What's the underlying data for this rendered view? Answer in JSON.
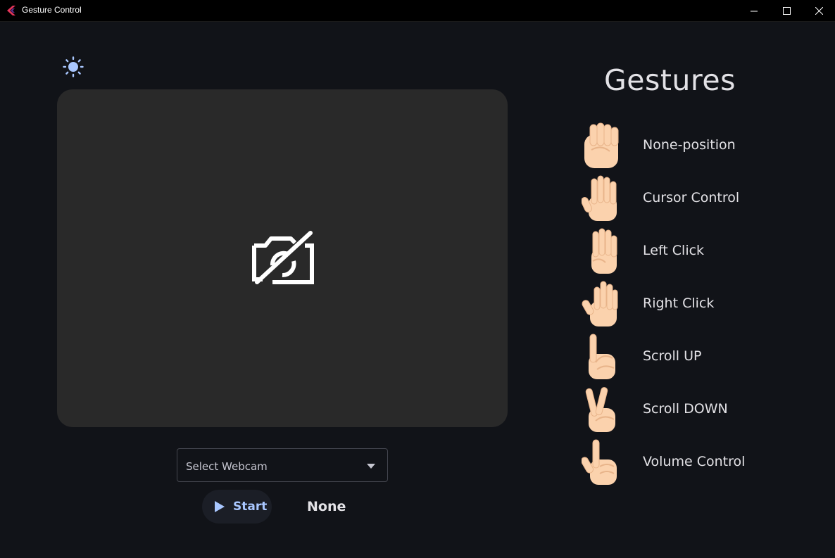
{
  "window": {
    "title": "Gesture Control"
  },
  "controls": {
    "webcam_placeholder": "Select Webcam",
    "start_label": "Start",
    "status": "None"
  },
  "gestures": {
    "title": "Gestures",
    "items": [
      {
        "label": "None-position",
        "icon": "fist-hand-icon"
      },
      {
        "label": "Cursor Control",
        "icon": "open-palm-icon"
      },
      {
        "label": "Left Click",
        "icon": "four-fingers-icon"
      },
      {
        "label": "Right Click",
        "icon": "three-fingers-icon"
      },
      {
        "label": "Scroll UP",
        "icon": "index-finger-up-icon"
      },
      {
        "label": "Scroll DOWN",
        "icon": "victory-hand-icon"
      },
      {
        "label": "Volume Control",
        "icon": "pinky-thumb-hand-icon"
      }
    ]
  },
  "colors": {
    "background": "#111318",
    "preview_bg": "#292929",
    "accent": "#a9c7ff",
    "skin": "#fbd2ad"
  }
}
